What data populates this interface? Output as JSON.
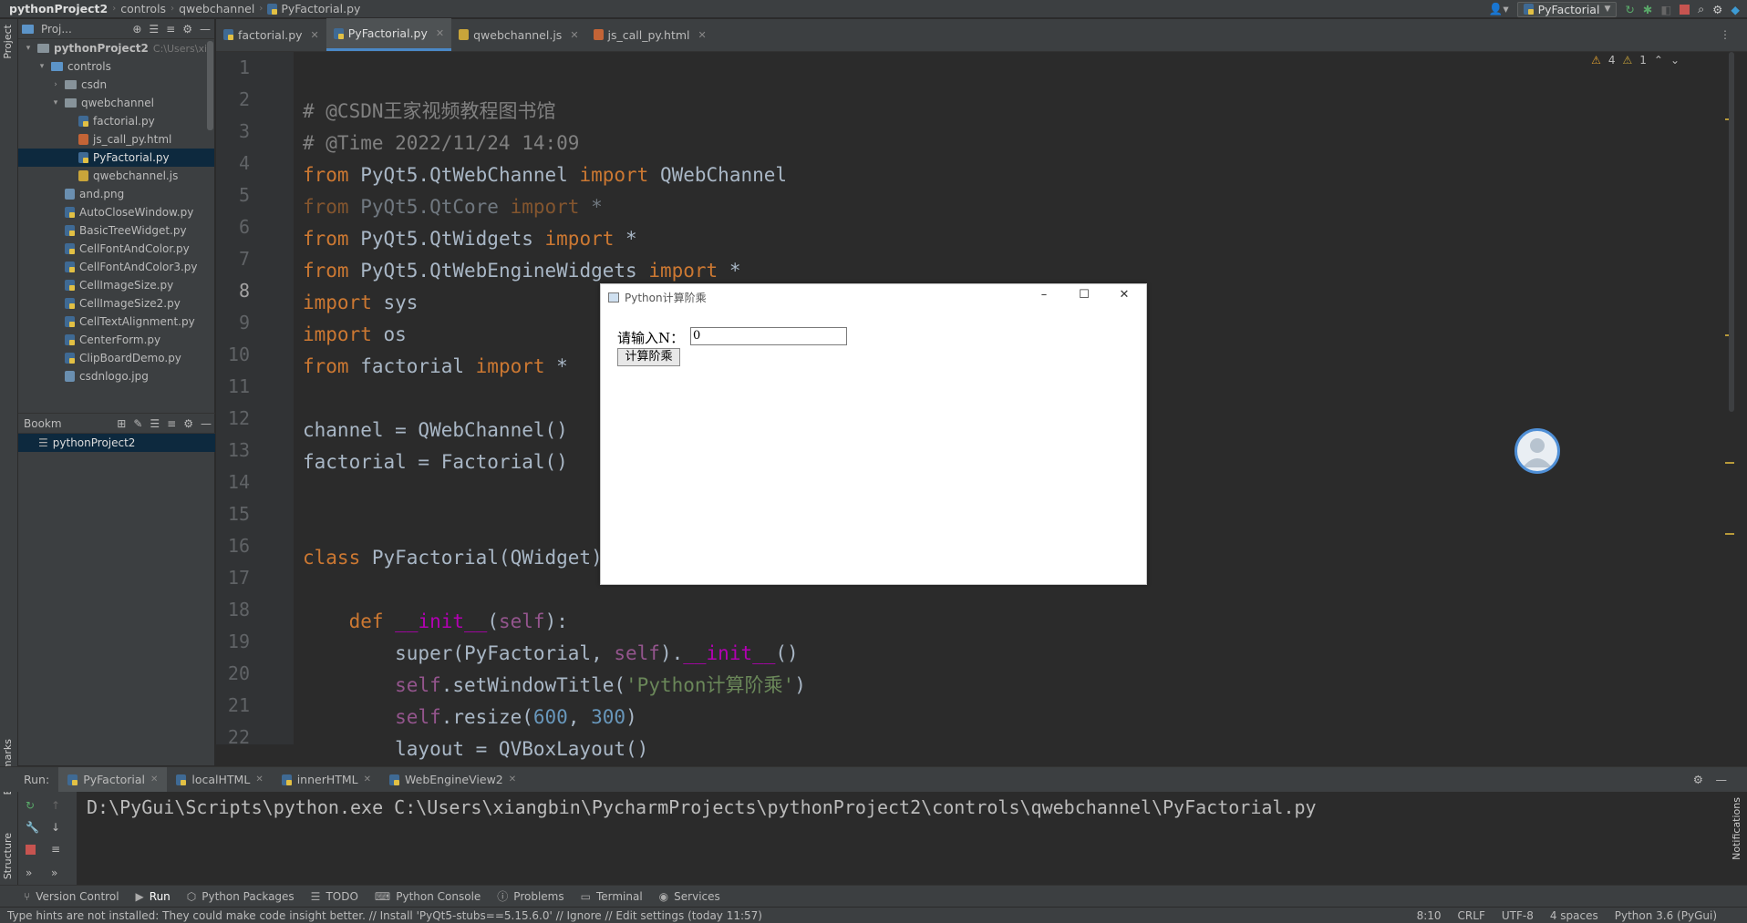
{
  "breadcrumb": [
    "pythonProject2",
    "controls",
    "qwebchannel",
    "PyFactorial.py"
  ],
  "toolbar": {
    "run_config": "PyFactorial"
  },
  "side_tabs": {
    "project": "Project",
    "bookmarks": "Bookmarks",
    "structure": "Structure",
    "notifications": "Notifications"
  },
  "project_panel": {
    "title": "Proj...",
    "tree": [
      {
        "label": "pythonProject2",
        "extra": "C:\\Users\\xia",
        "indent": 0,
        "type": "folder",
        "expanded": true
      },
      {
        "label": "controls",
        "indent": 1,
        "type": "folder-blue",
        "expanded": true
      },
      {
        "label": "csdn",
        "indent": 2,
        "type": "folder",
        "expanded": false
      },
      {
        "label": "qwebchannel",
        "indent": 2,
        "type": "folder",
        "expanded": true
      },
      {
        "label": "factorial.py",
        "indent": 3,
        "type": "py"
      },
      {
        "label": "js_call_py.html",
        "indent": 3,
        "type": "html"
      },
      {
        "label": "PyFactorial.py",
        "indent": 3,
        "type": "py",
        "selected": true
      },
      {
        "label": "qwebchannel.js",
        "indent": 3,
        "type": "js"
      },
      {
        "label": "and.png",
        "indent": 2,
        "type": "img"
      },
      {
        "label": "AutoCloseWindow.py",
        "indent": 2,
        "type": "py"
      },
      {
        "label": "BasicTreeWidget.py",
        "indent": 2,
        "type": "py"
      },
      {
        "label": "CellFontAndColor.py",
        "indent": 2,
        "type": "py"
      },
      {
        "label": "CellFontAndColor3.py",
        "indent": 2,
        "type": "py"
      },
      {
        "label": "CellImageSize.py",
        "indent": 2,
        "type": "py"
      },
      {
        "label": "CellImageSize2.py",
        "indent": 2,
        "type": "py"
      },
      {
        "label": "CellTextAlignment.py",
        "indent": 2,
        "type": "py"
      },
      {
        "label": "CenterForm.py",
        "indent": 2,
        "type": "py"
      },
      {
        "label": "ClipBoardDemo.py",
        "indent": 2,
        "type": "py"
      },
      {
        "label": "csdnlogo.jpg",
        "indent": 2,
        "type": "img"
      }
    ]
  },
  "bookmarks_panel": {
    "title": "Bookm",
    "item": "pythonProject2"
  },
  "editor_tabs": [
    {
      "label": "factorial.py",
      "type": "py",
      "active": false
    },
    {
      "label": "PyFactorial.py",
      "type": "py",
      "active": true
    },
    {
      "label": "qwebchannel.js",
      "type": "js",
      "active": false
    },
    {
      "label": "js_call_py.html",
      "type": "html",
      "active": false
    }
  ],
  "inspections": {
    "warnings": "4",
    "weak": "1"
  },
  "editor": {
    "line_numbers": [
      "1",
      "2",
      "3",
      "4",
      "5",
      "6",
      "7",
      "8",
      "9",
      "10",
      "11",
      "12",
      "13",
      "14",
      "15",
      "16",
      "17",
      "18",
      "19",
      "20",
      "21",
      "22"
    ],
    "current_line": "8"
  },
  "code_lines": [
    [
      {
        "t": "# @CSDN王家视频教程图书馆",
        "c": "c"
      }
    ],
    [
      {
        "t": "# @Time 2022/11/24 14:09",
        "c": "c"
      }
    ],
    [
      {
        "t": "from",
        "c": "k"
      },
      {
        "t": " PyQt5.QtWebChannel "
      },
      {
        "t": "import",
        "c": "k"
      },
      {
        "t": " QWebChannel"
      }
    ],
    [
      {
        "t": "from",
        "c": "k dim"
      },
      {
        "t": " PyQt5.QtCore ",
        "c": "dim"
      },
      {
        "t": "import",
        "c": "k dim"
      },
      {
        "t": " *",
        "c": "dim"
      }
    ],
    [
      {
        "t": "from",
        "c": "k"
      },
      {
        "t": " PyQt5.QtWidgets "
      },
      {
        "t": "import",
        "c": "k"
      },
      {
        "t": " *"
      }
    ],
    [
      {
        "t": "from",
        "c": "k"
      },
      {
        "t": " PyQt5.QtWebEngineWidgets "
      },
      {
        "t": "import",
        "c": "k"
      },
      {
        "t": " *"
      }
    ],
    [
      {
        "t": "import",
        "c": "k"
      },
      {
        "t": " sys"
      }
    ],
    [
      {
        "t": "import",
        "c": "k"
      },
      {
        "t": " os"
      }
    ],
    [
      {
        "t": "from",
        "c": "k"
      },
      {
        "t": " factorial "
      },
      {
        "t": "import",
        "c": "k"
      },
      {
        "t": " *"
      }
    ],
    [],
    [
      {
        "t": "channel = QWebChannel()"
      }
    ],
    [
      {
        "t": "factorial = Factorial()"
      }
    ],
    [],
    [],
    [
      {
        "t": "class",
        "c": "k"
      },
      {
        "t": " PyFactorial(QWidget):"
      }
    ],
    [],
    [
      {
        "t": "    "
      },
      {
        "t": "def",
        "c": "k"
      },
      {
        "t": " "
      },
      {
        "t": "__init__",
        "c": "mg"
      },
      {
        "t": "("
      },
      {
        "t": "self",
        "c": "sf"
      },
      {
        "t": "):"
      }
    ],
    [
      {
        "t": "        super(PyFactorial, "
      },
      {
        "t": "self",
        "c": "sf"
      },
      {
        "t": ")."
      },
      {
        "t": "__init__",
        "c": "mg"
      },
      {
        "t": "()"
      }
    ],
    [
      {
        "t": "        "
      },
      {
        "t": "self",
        "c": "sf"
      },
      {
        "t": ".setWindowTitle("
      },
      {
        "t": "'Python计算阶乘'",
        "c": "s"
      },
      {
        "t": ")"
      }
    ],
    [
      {
        "t": "        "
      },
      {
        "t": "self",
        "c": "sf"
      },
      {
        "t": ".resize("
      },
      {
        "t": "600",
        "c": "n"
      },
      {
        "t": ", "
      },
      {
        "t": "300",
        "c": "n"
      },
      {
        "t": ")"
      }
    ],
    [
      {
        "t": "        layout = QVBoxLayout()"
      }
    ],
    []
  ],
  "pywindow": {
    "title": "Python计算阶乘",
    "label": "请输入N：",
    "input_value": "0",
    "button": "计算阶乘"
  },
  "run_panel": {
    "label": "Run:",
    "tabs": [
      "PyFactorial",
      "localHTML",
      "innerHTML",
      "WebEngineView2"
    ],
    "console": "D:\\PyGui\\Scripts\\python.exe C:\\Users\\xiangbin\\PycharmProjects\\pythonProject2\\controls\\qwebchannel\\PyFactorial.py"
  },
  "tool_windows": [
    "Version Control",
    "Run",
    "Python Packages",
    "TODO",
    "Python Console",
    "Problems",
    "Terminal",
    "Services"
  ],
  "status": {
    "message": "Type hints are not installed: They could make code insight better. // Install 'PyQt5-stubs==5.15.6.0' // Ignore // Edit settings (today 11:57)",
    "position": "8:10",
    "line_sep": "CRLF",
    "encoding": "UTF-8",
    "indent": "4 spaces",
    "interpreter": "Python 3.6 (PyGui)"
  },
  "colors": {
    "accent": "#4a88c7",
    "keyword": "#cc7832",
    "string": "#6a8759",
    "number": "#6897bb",
    "comment": "#808080"
  }
}
